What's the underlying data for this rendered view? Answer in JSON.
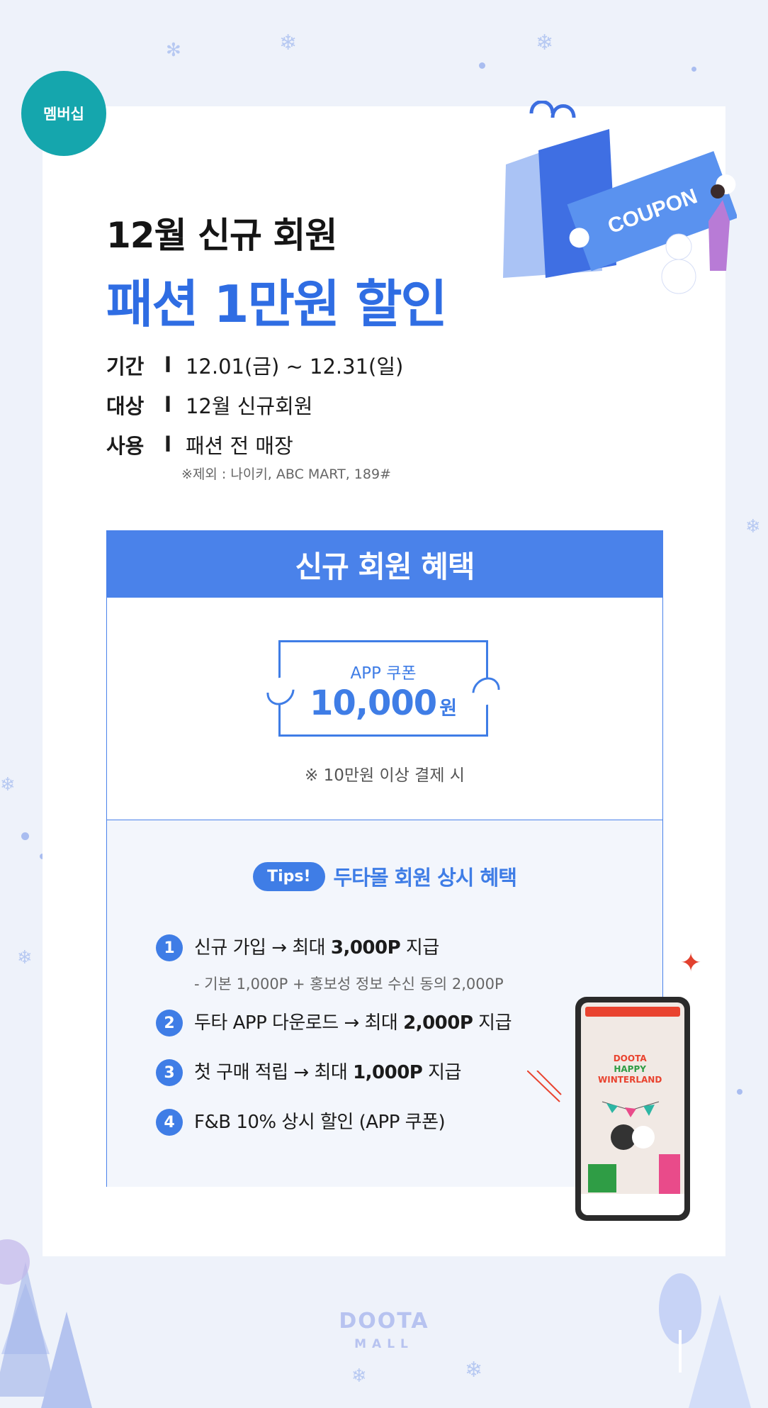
{
  "badge": "멤버십",
  "headline": {
    "line1": "12월 신규 회원",
    "line2": "패션 1만원 할인"
  },
  "info": [
    {
      "label": "기간",
      "sep": "l",
      "value": "12.01(금) ~ 12.31(일)"
    },
    {
      "label": "대상",
      "sep": "l",
      "value": "12월 신규회원"
    },
    {
      "label": "사용",
      "sep": "l",
      "value": "패션 전 매장"
    }
  ],
  "info_note": "※제외 : 나이키, ABC MART, 189#",
  "illustration": {
    "coupon_text": "COUPON"
  },
  "benefit": {
    "title": "신규 회원 혜택",
    "coupon_label": "APP 쿠폰",
    "coupon_amount": "10,000",
    "coupon_unit": "원",
    "coupon_note": "※ 10만원 이상 결제 시"
  },
  "tips": {
    "pill": "Tips!",
    "title": "두타몰 회원 상시 혜택",
    "items": [
      {
        "num": "1",
        "pre": "신규 가입 → 최대 ",
        "bold": "3,000P",
        "post": " 지급"
      },
      {
        "num": "2",
        "pre": "두타 APP 다운로드 → 최대 ",
        "bold": "2,000P",
        "post": " 지급"
      },
      {
        "num": "3",
        "pre": "첫 구매 적립 → 최대 ",
        "bold": "1,000P",
        "post": " 지급"
      },
      {
        "num": "4",
        "pre": "F&B 10% 상시 할인 (APP 쿠폰)",
        "bold": "",
        "post": ""
      }
    ],
    "sub_note": "- 기본 1,000P + 홍보성 정보 수신 동의 2,000P"
  },
  "phone": {
    "logo_line1": "DOOTA",
    "logo_line2": "HAPPY",
    "logo_line3": "WINTERLAND"
  },
  "footer_logo": {
    "line1": "DOOTA",
    "line2": "MALL"
  },
  "colors": {
    "accent": "#2f6de3",
    "badge": "#15a6ad",
    "background": "#eef2fa"
  }
}
